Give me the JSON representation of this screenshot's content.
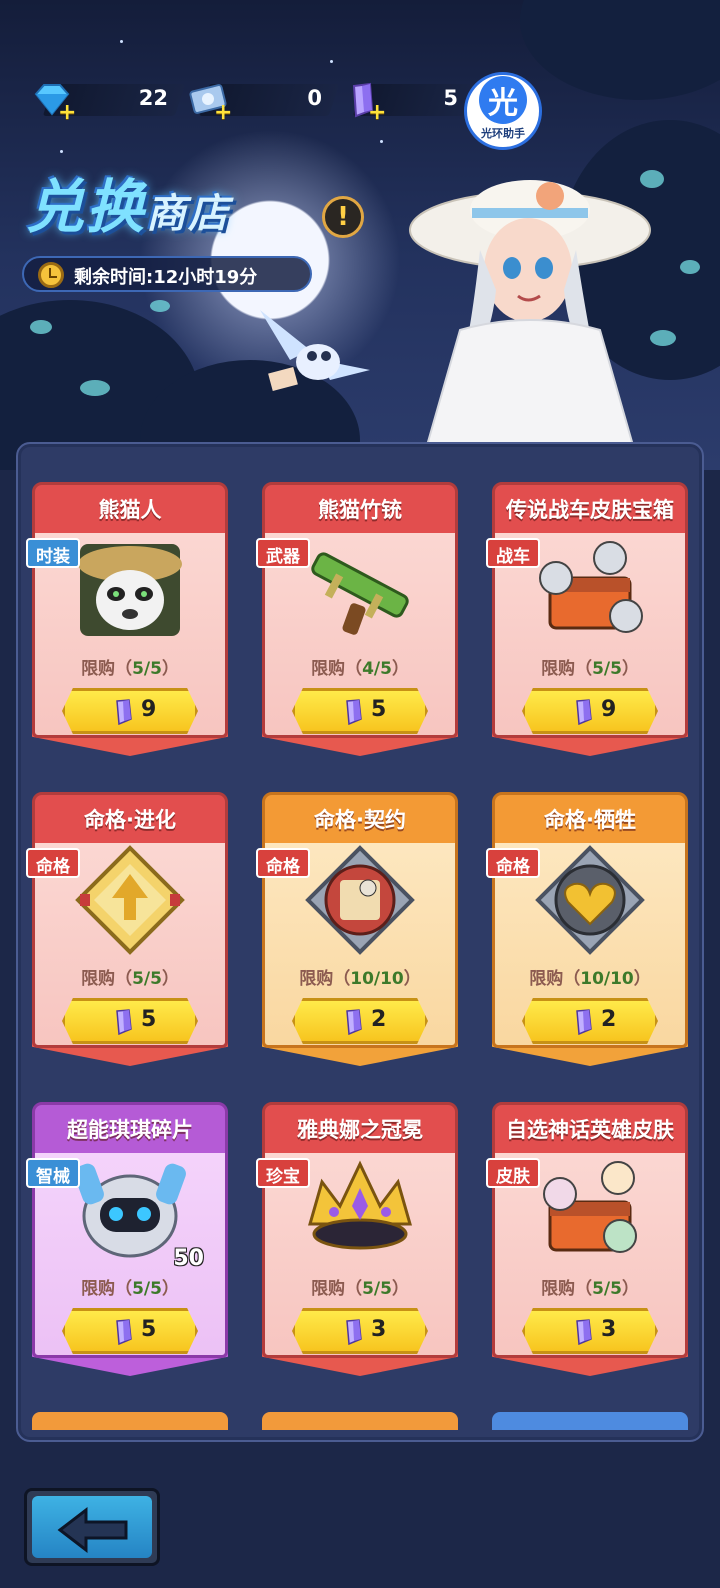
{
  "currencies": [
    {
      "icon": "diamond-icon",
      "value": "22"
    },
    {
      "icon": "ticket-icon",
      "value": "0"
    },
    {
      "icon": "crystal-icon",
      "value": "5"
    }
  ],
  "helper": {
    "glyph": "光",
    "label": "光环助手"
  },
  "shop": {
    "title_main": "兑换",
    "title_sub": "商店",
    "info_glyph": "!",
    "timer": "剩余时间:12小时19分"
  },
  "colors": {
    "accent": "#f7c51f",
    "panel": "#2e3b66"
  },
  "items": [
    {
      "name": "熊猫人",
      "tag": "时装",
      "tag_color": "blue",
      "theme": "red",
      "limit_label": "限购（",
      "limit": "5/5",
      "limit_end": "）",
      "price": "9",
      "icon": "panda-hero-icon",
      "count": ""
    },
    {
      "name": "熊猫竹铳",
      "tag": "武器",
      "tag_color": "red",
      "theme": "red",
      "limit_label": "限购（",
      "limit": "4/5",
      "limit_end": "）",
      "price": "5",
      "icon": "bamboo-gun-icon",
      "count": ""
    },
    {
      "name": "传说战车皮肤宝箱",
      "tag": "战车",
      "tag_color": "red",
      "theme": "red",
      "limit_label": "限购（",
      "limit": "5/5",
      "limit_end": "）",
      "price": "9",
      "icon": "chariot-chest-icon",
      "count": ""
    },
    {
      "name": "命格·进化",
      "tag": "命格",
      "tag_color": "red",
      "theme": "red",
      "limit_label": "限购（",
      "limit": "5/5",
      "limit_end": "）",
      "price": "5",
      "icon": "evolution-rune-icon",
      "count": ""
    },
    {
      "name": "命格·契约",
      "tag": "命格",
      "tag_color": "red",
      "theme": "orange",
      "limit_label": "限购（",
      "limit": "10/10",
      "limit_end": "）",
      "price": "2",
      "icon": "contract-rune-icon",
      "count": ""
    },
    {
      "name": "命格·牺牲",
      "tag": "命格",
      "tag_color": "red",
      "theme": "orange",
      "limit_label": "限购（",
      "limit": "10/10",
      "limit_end": "）",
      "price": "2",
      "icon": "sacrifice-rune-icon",
      "count": ""
    },
    {
      "name": "超能琪琪碎片",
      "tag": "智械",
      "tag_color": "blue",
      "theme": "purple",
      "limit_label": "限购（",
      "limit": "5/5",
      "limit_end": "）",
      "price": "5",
      "icon": "robot-fragment-icon",
      "count": "50"
    },
    {
      "name": "雅典娜之冠冕",
      "tag": "珍宝",
      "tag_color": "red",
      "theme": "red",
      "limit_label": "限购（",
      "limit": "5/5",
      "limit_end": "）",
      "price": "3",
      "icon": "crown-icon",
      "count": ""
    },
    {
      "name": "自选神话英雄皮肤",
      "tag": "皮肤",
      "tag_color": "red",
      "theme": "red",
      "limit_label": "限购（",
      "limit": "5/5",
      "limit_end": "）",
      "price": "3",
      "icon": "hero-skin-chest-icon",
      "count": ""
    }
  ],
  "back": {
    "icon": "back-arrow-icon"
  }
}
